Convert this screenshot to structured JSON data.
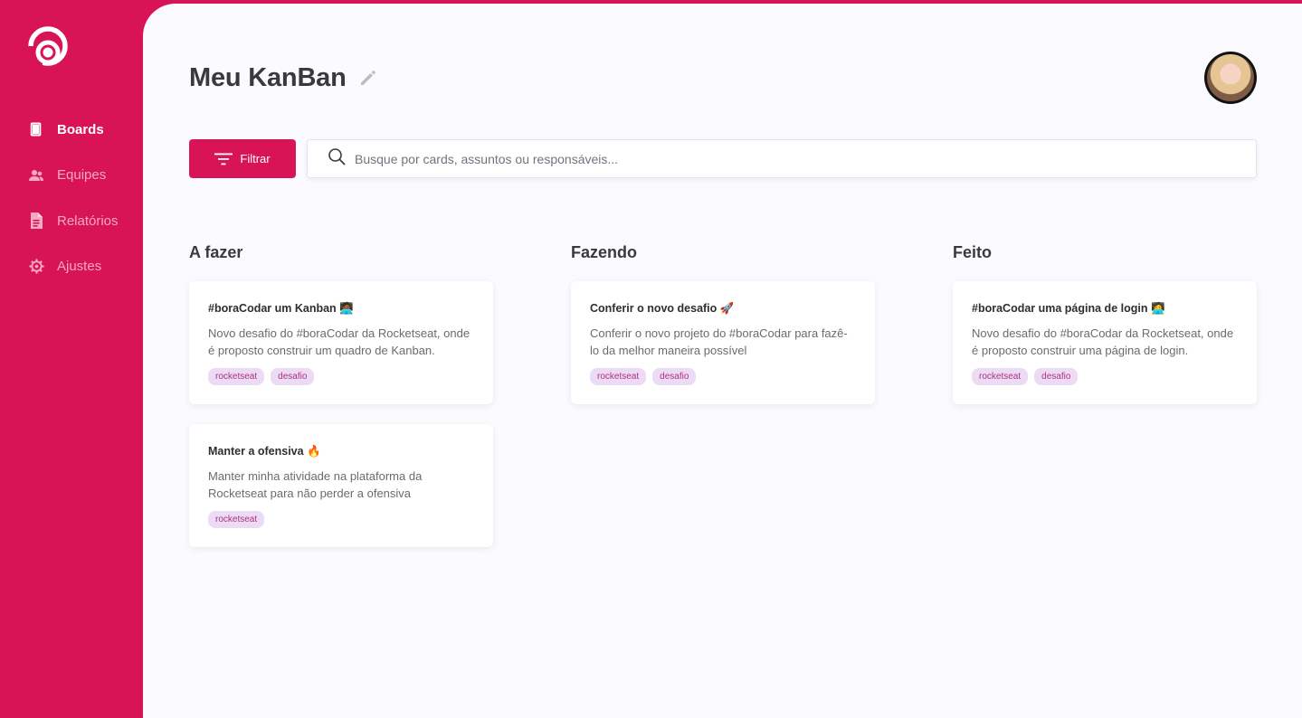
{
  "colors": {
    "accent": "#D81356",
    "background": "#FBFAFF",
    "tag_bg": "#EBDBF5",
    "tag_text": "#B2307F"
  },
  "sidebar": {
    "logo_icon": "rocket-logo-icon",
    "items": [
      {
        "label": "Boards",
        "icon": "board-icon",
        "active": true
      },
      {
        "label": "Equipes",
        "icon": "team-icon",
        "active": false
      },
      {
        "label": "Relatórios",
        "icon": "report-icon",
        "active": false
      },
      {
        "label": "Ajustes",
        "icon": "gear-icon",
        "active": false
      }
    ]
  },
  "header": {
    "title": "Meu KanBan",
    "edit_icon": "pencil-icon",
    "avatar_icon": "user-avatar"
  },
  "toolbar": {
    "filter_label": "Filtrar",
    "search_placeholder": "Busque por cards, assuntos ou responsáveis..."
  },
  "columns": [
    {
      "title": "A fazer",
      "cards": [
        {
          "title": "#boraCodar um Kanban 🧑🏾‍💻",
          "description": "Novo desafio do #boraCodar da Rocketseat, onde é proposto construir um quadro de Kanban.",
          "tags": [
            "rocketseat",
            "desafio"
          ]
        },
        {
          "title": "Manter a ofensiva 🔥",
          "description": "Manter minha atividade na plataforma da Rocketseat para não perder a ofensiva",
          "tags": [
            "rocketseat"
          ]
        }
      ]
    },
    {
      "title": "Fazendo",
      "cards": [
        {
          "title": "Conferir o novo desafio 🚀",
          "description": "Conferir o novo projeto do #boraCodar para fazê-lo da melhor maneira possível",
          "tags": [
            "rocketseat",
            "desafio"
          ]
        }
      ]
    },
    {
      "title": "Feito",
      "cards": [
        {
          "title": "#boraCodar uma página de login 🧑‍💻",
          "description": "Novo desafio do #boraCodar da Rocketseat, onde é proposto construir uma página de login.",
          "tags": [
            "rocketseat",
            "desafio"
          ]
        }
      ]
    }
  ]
}
